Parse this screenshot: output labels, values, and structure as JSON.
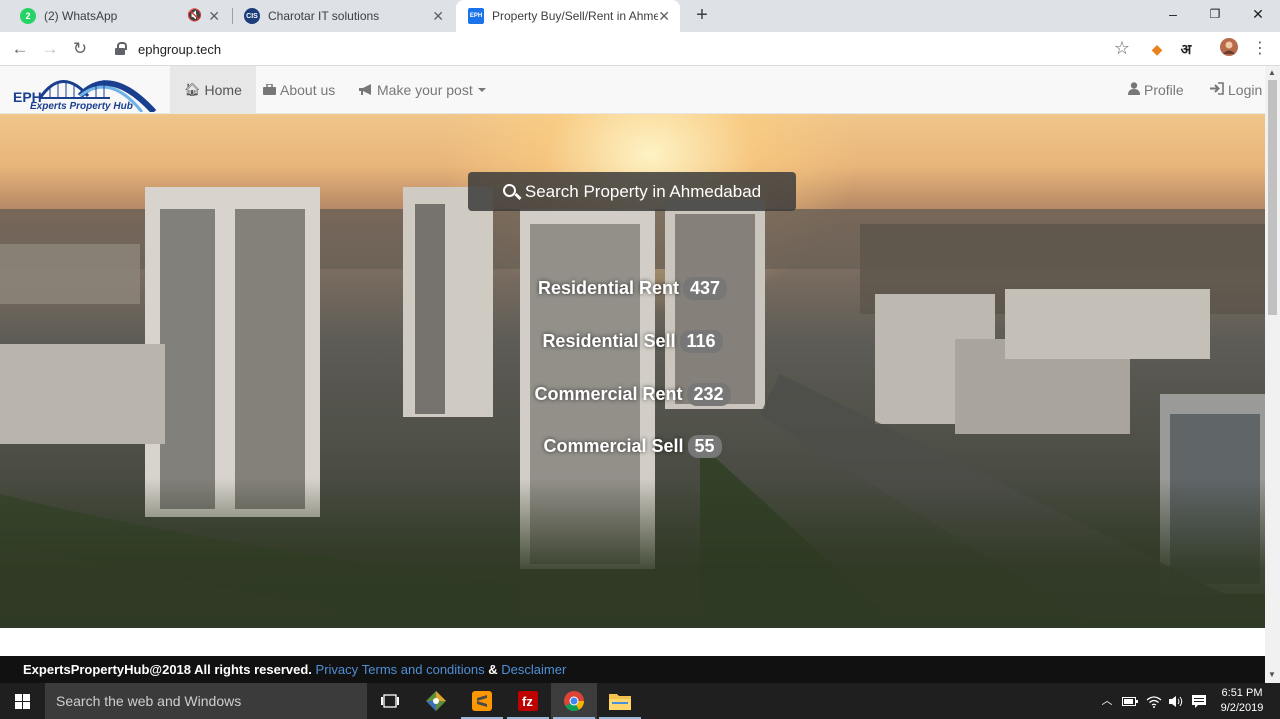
{
  "browser": {
    "tabs": [
      {
        "title": "(2) WhatsApp",
        "favicon_text": "2",
        "favicon_color": "#25d366"
      },
      {
        "title": "Charotar IT solutions",
        "favicon_text": "CIS",
        "favicon_color": "#1c3d7a"
      },
      {
        "title": "Property Buy/Sell/Rent in Ahmed",
        "favicon_text": "EPH",
        "favicon_color": "#1a73e8"
      }
    ],
    "new_tab": "+",
    "address": "ephgroup.tech",
    "window_controls": {
      "minimize": "–",
      "maximize": "❐",
      "close": "✕"
    }
  },
  "site": {
    "logo": {
      "main": "EPH",
      "sub": "Experts Property Hub"
    },
    "nav": {
      "home": "Home",
      "about": "About us",
      "post": "Make your post",
      "profile": "Profile",
      "login": "Login"
    },
    "hero": {
      "search_label": "Search Property in Ahmedabad",
      "stats": [
        {
          "label": "Residential Rent",
          "count": "437"
        },
        {
          "label": "Residential Sell",
          "count": "116"
        },
        {
          "label": "Commercial Rent",
          "count": "232"
        },
        {
          "label": "Commercial Sell",
          "count": "55"
        }
      ]
    },
    "footer": {
      "copyright": "ExpertsPropertyHub@2018 All rights reserved.",
      "privacy": "Privacy",
      "terms": "Terms and conditions",
      "amp": "&",
      "disclaimer": "Desclaimer"
    }
  },
  "taskbar": {
    "search_placeholder": "Search the web and Windows",
    "time": "6:51 PM",
    "date": "9/2/2019"
  },
  "colors": {
    "accent_link": "#4f8fd6",
    "badge": "#777777",
    "footer_bg": "#111111"
  }
}
